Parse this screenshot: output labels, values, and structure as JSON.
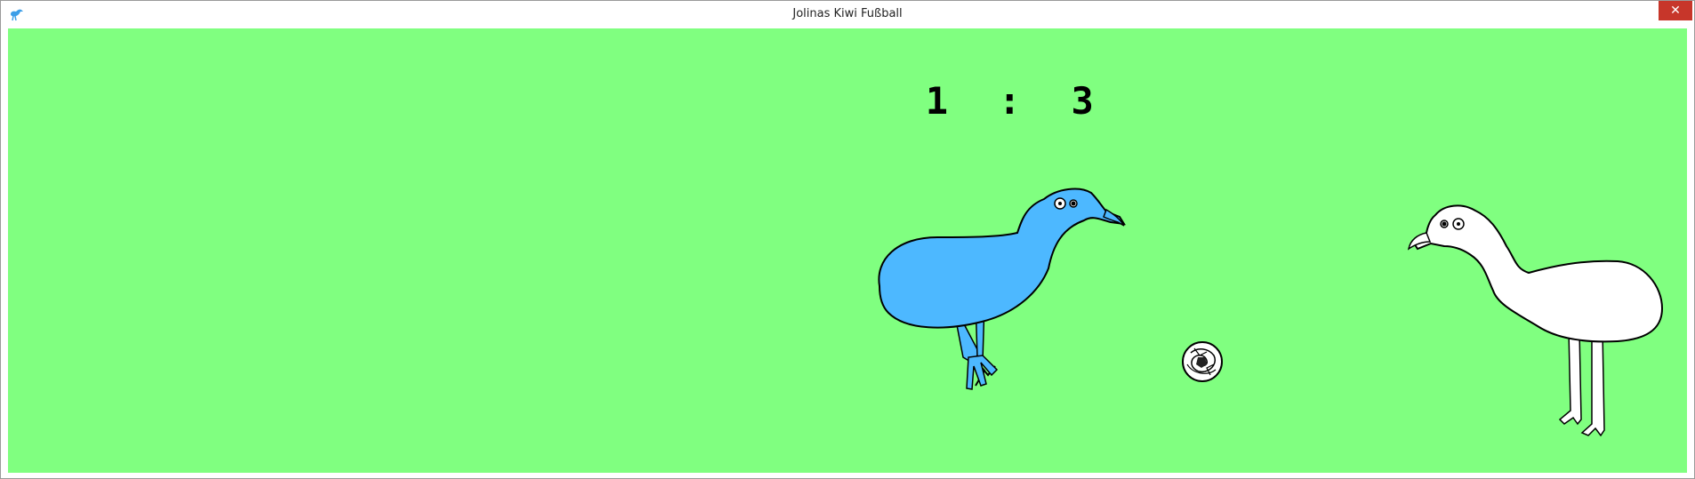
{
  "window": {
    "title": "Jolinas Kiwi Fußball",
    "close_label": "✕",
    "icon": "kiwi-app-icon"
  },
  "game": {
    "field_color": "#80ff80",
    "score": {
      "left": "1",
      "separator": ":",
      "right": "3"
    },
    "players": [
      {
        "name": "blue-kiwi",
        "color": "#4db8ff"
      },
      {
        "name": "white-kiwi",
        "color": "#ffffff"
      }
    ],
    "ball": {
      "name": "soccer-ball"
    }
  }
}
